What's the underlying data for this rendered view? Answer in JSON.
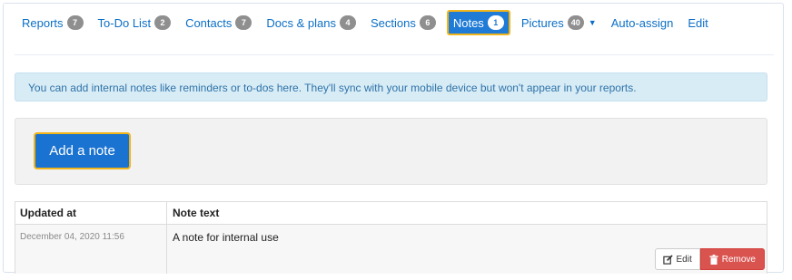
{
  "tabs": [
    {
      "label": "Reports",
      "badge": "7"
    },
    {
      "label": "To-Do List",
      "badge": "2"
    },
    {
      "label": "Contacts",
      "badge": "7"
    },
    {
      "label": "Docs & plans",
      "badge": "4"
    },
    {
      "label": "Sections",
      "badge": "6"
    },
    {
      "label": "Notes",
      "badge": "1",
      "active": true
    },
    {
      "label": "Pictures",
      "badge": "40",
      "dropdown": true
    },
    {
      "label": "Auto-assign"
    },
    {
      "label": "Edit"
    }
  ],
  "info": {
    "text": "You can add internal notes like reminders or to-dos here. They'll sync with your mobile device but won't appear in your reports."
  },
  "actions": {
    "add_note_label": "Add a note"
  },
  "table": {
    "headers": [
      "Updated at",
      "Note text"
    ],
    "rows": [
      {
        "updated_at": "December 04, 2020 11:56",
        "note_text": "A note for internal use"
      }
    ],
    "edit_label": "Edit",
    "remove_label": "Remove"
  },
  "colors": {
    "link": "#0b6fc7",
    "active_tab": "#1f7bd6",
    "highlight_border": "#f1b51c",
    "info_bg": "#d8ecf6",
    "danger": "#d9534f"
  },
  "icons": {
    "dropdown": "caret-down-icon",
    "edit": "edit-icon",
    "remove": "trash-icon"
  }
}
